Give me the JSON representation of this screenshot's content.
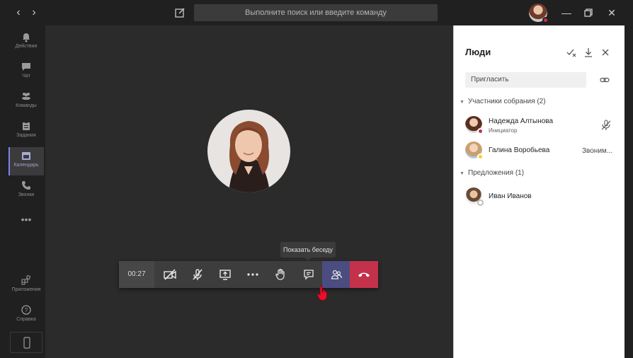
{
  "titlebar": {
    "back_glyph": "‹",
    "forward_glyph": "›",
    "search_placeholder": "Выполните поиск или введите команду",
    "minimize_glyph": "—",
    "close_glyph": "✕"
  },
  "rail": {
    "items": [
      {
        "label": "Действия",
        "icon": "bell-icon"
      },
      {
        "label": "Чат",
        "icon": "chat-icon"
      },
      {
        "label": "Команды",
        "icon": "teams-icon"
      },
      {
        "label": "Задания",
        "icon": "assignments-icon"
      },
      {
        "label": "Календарь",
        "icon": "calendar-icon",
        "active": true
      },
      {
        "label": "Звонки",
        "icon": "phone-icon"
      },
      {
        "label": "Приложения",
        "icon": "apps-icon"
      },
      {
        "label": "Справка",
        "icon": "help-icon"
      }
    ],
    "more_glyph": "•••"
  },
  "call": {
    "timer": "00:27",
    "tooltip": "Показать беседу",
    "controls": [
      "camera-off-icon",
      "mic-off-icon",
      "share-screen-icon",
      "more-icon",
      "raise-hand-icon",
      "chat-icon",
      "people-icon",
      "hangup-icon"
    ]
  },
  "panel": {
    "title": "Люди",
    "invite_placeholder": "Пригласить",
    "sections": [
      {
        "label": "Участники собрания (2)"
      },
      {
        "label": "Предложения (1)"
      }
    ],
    "participants": [
      {
        "name": "Надежда Алтынова",
        "role": "Инициатор",
        "status_color": "#c4314b"
      },
      {
        "name": "Галина Воробьева",
        "state": "Звоним...",
        "status_color": "#f8d22a"
      }
    ],
    "suggestions": [
      {
        "name": "Иван Иванов"
      }
    ]
  },
  "colors": {
    "accent": "#4b4c7f",
    "hangup": "#c4314b",
    "rail_active": "#7b83eb"
  }
}
